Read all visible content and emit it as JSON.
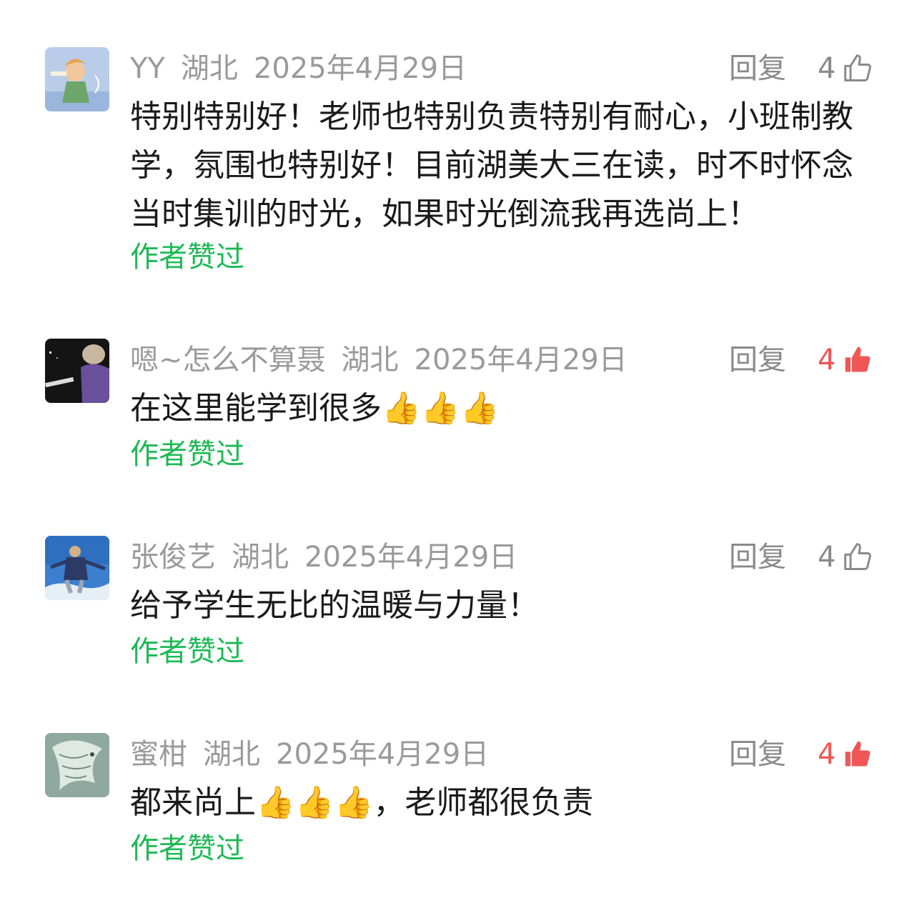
{
  "comments": [
    {
      "name": "YY",
      "region": "湖北",
      "date": "2025年4月29日",
      "reply_label": "回复",
      "likes": "4",
      "liked": false,
      "text": "特别特别好！老师也特别负责特别有耐心，小班制教学，氛围也特别好！目前湖美大三在读，时不时怀念当时集训的时光，如果时光倒流我再选尚上！",
      "author_liked": "作者赞过"
    },
    {
      "name": "嗯~怎么不算聂",
      "region": "湖北",
      "date": "2025年4月29日",
      "reply_label": "回复",
      "likes": "4",
      "liked": true,
      "text": "在这里能学到很多👍👍👍",
      "author_liked": "作者赞过"
    },
    {
      "name": "张俊艺",
      "region": "湖北",
      "date": "2025年4月29日",
      "reply_label": "回复",
      "likes": "4",
      "liked": false,
      "text": "给予学生无比的温暖与力量！",
      "author_liked": "作者赞过"
    },
    {
      "name": "蜜柑",
      "region": "湖北",
      "date": "2025年4月29日",
      "reply_label": "回复",
      "likes": "4",
      "liked": true,
      "text": "都来尚上👍👍👍，老师都很负责",
      "author_liked": "作者赞过"
    }
  ],
  "colors": {
    "meta": "#9a9a9a",
    "author_liked": "#1db954",
    "like_active": "#f05656"
  },
  "icons": {
    "like_outline": "thumbs-up-outline-icon",
    "like_filled": "thumbs-up-filled-icon"
  }
}
